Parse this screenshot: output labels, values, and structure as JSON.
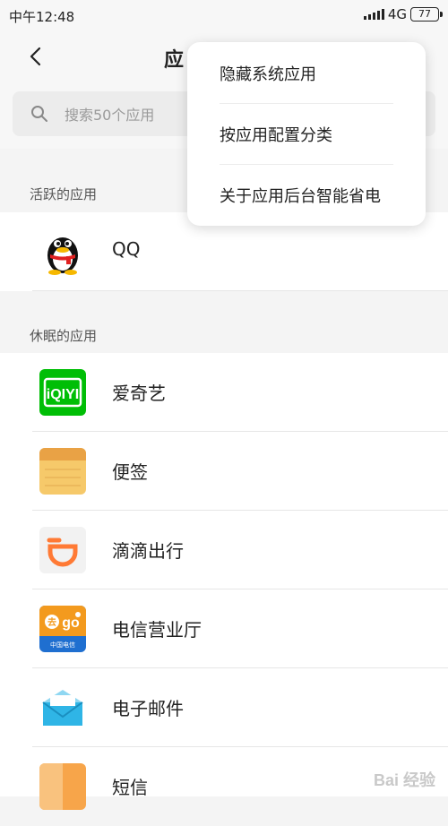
{
  "status": {
    "time": "中午12:48",
    "network": "4G",
    "battery": "77"
  },
  "header": {
    "title": "应"
  },
  "search": {
    "placeholder": "搜索50个应用"
  },
  "sections": {
    "active": "活跃的应用",
    "sleeping": "休眠的应用"
  },
  "active_apps": [
    {
      "name": "QQ",
      "icon": "qq-penguin-icon"
    }
  ],
  "sleeping_apps": [
    {
      "name": "爱奇艺",
      "icon": "iqiyi-icon"
    },
    {
      "name": "便签",
      "icon": "notes-icon"
    },
    {
      "name": "滴滴出行",
      "icon": "didi-icon"
    },
    {
      "name": "电信营业厅",
      "icon": "telecom-icon"
    },
    {
      "name": "电子邮件",
      "icon": "email-icon"
    },
    {
      "name": "短信",
      "icon": "sms-icon"
    }
  ],
  "menu": {
    "items": [
      "隐藏系统应用",
      "按应用配置分类",
      "关于应用后台智能省电"
    ]
  },
  "watermark": "Bai 经验",
  "colors": {
    "iqiyi": "#00be06",
    "notes": "#f6c96a",
    "didi": "#ff7a35",
    "telecom": "#1f6fd0",
    "email": "#2fb5e6"
  }
}
